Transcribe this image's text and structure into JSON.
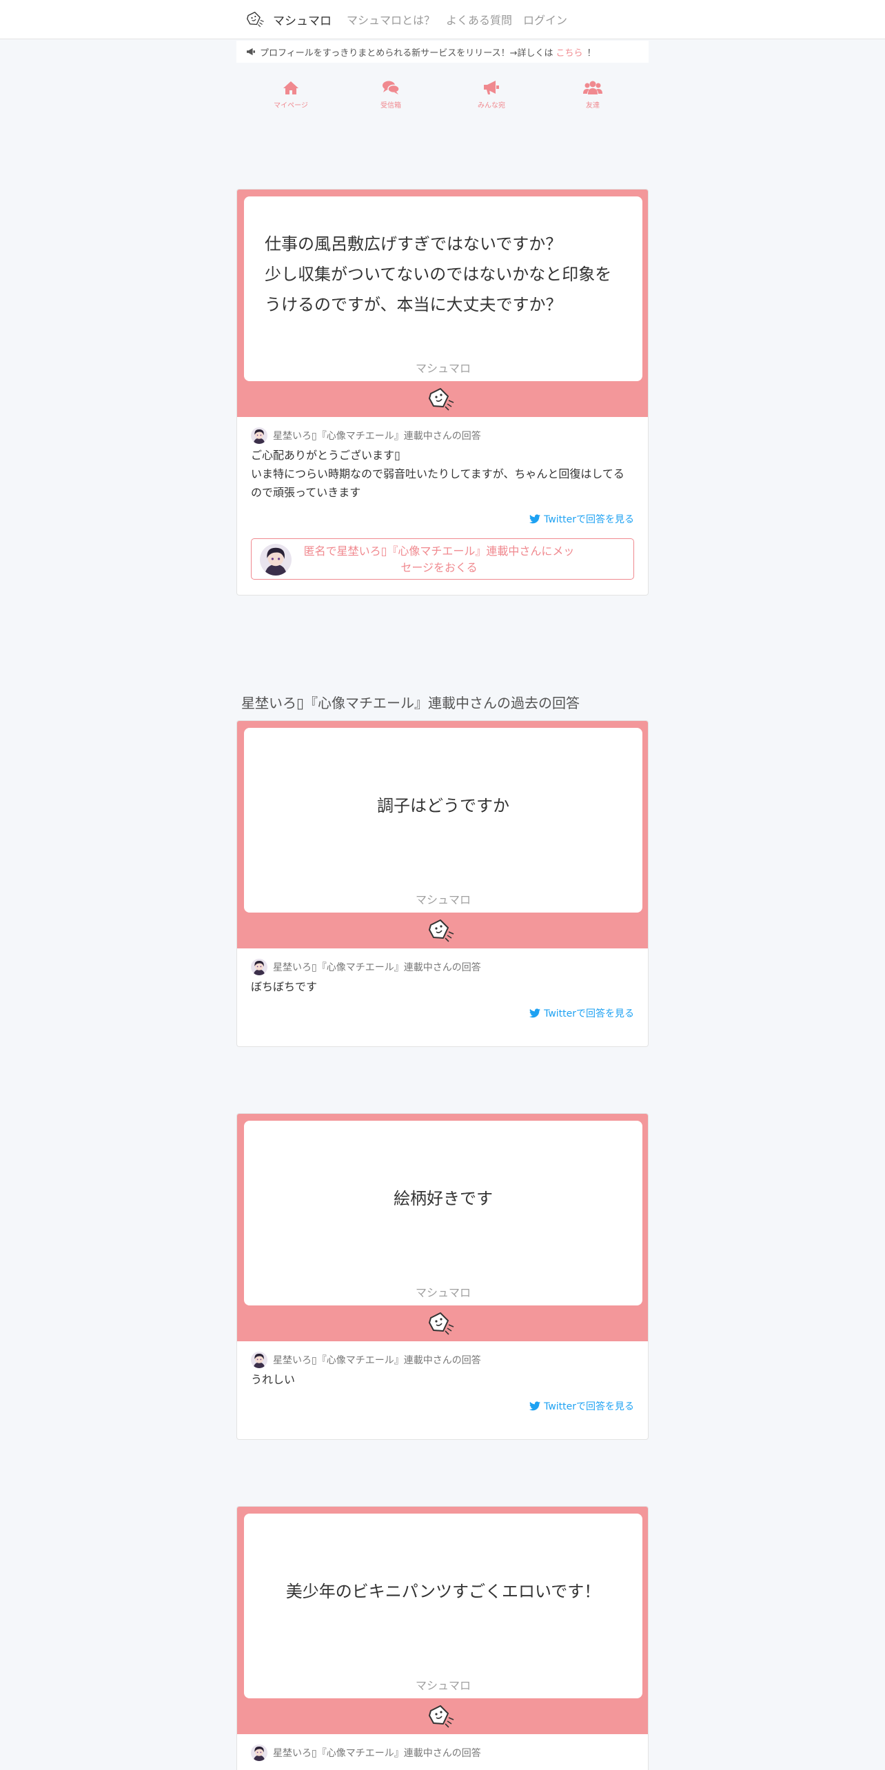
{
  "navbar": {
    "brand": "マシュマロ",
    "links": [
      "マシュマロとは？",
      "よくある質問",
      "ログイン"
    ]
  },
  "announcement": {
    "text": "プロフィールをすっきりまとめられる新サービスをリリース！→詳しくは",
    "link": "こちら",
    "suffix": "！"
  },
  "tabs": [
    {
      "label": "マイページ",
      "icon": "home-icon"
    },
    {
      "label": "受信箱",
      "icon": "comments-icon"
    },
    {
      "label": "みんな宛",
      "icon": "bullhorn-icon"
    },
    {
      "label": "友達",
      "icon": "users-icon"
    }
  ],
  "main": {
    "message": "仕事の風呂敷広げすぎではないですか？\n少し収集がついてないのではないかなと印象をうけるのですが、本当に大丈夫ですか？",
    "signature": "マシュマロ",
    "answer_by": "星埜いろ▯『心像マチエール』連載中さんの回答",
    "answer": "ご心配ありがとうございます▯\nいま特につらい時期なので弱音吐いたりしてますが、ちゃんと回復はしてるので頑張っていきます",
    "twitter_link": "Twitterで回答を見る",
    "send_button": "匿名で星埜いろ▯『心像マチエール』連載中さんにメッセージをおくる"
  },
  "past": {
    "title": "星埜いろ▯『心像マチエール』連載中さんの過去の回答",
    "items": [
      {
        "message": "調子はどうですか",
        "signature": "マシュマロ",
        "answer_by": "星埜いろ▯『心像マチエール』連載中さんの回答",
        "answer": "ぼちぼちです",
        "twitter_link": "Twitterで回答を見る"
      },
      {
        "message": "絵柄好きです",
        "signature": "マシュマロ",
        "answer_by": "星埜いろ▯『心像マチエール』連載中さんの回答",
        "answer": "うれしい",
        "twitter_link": "Twitterで回答を見る"
      },
      {
        "message": "美少年のビキニパンツすごくエロいです！",
        "signature": "マシュマロ",
        "answer_by": "星埜いろ▯『心像マチエール』連載中さんの回答"
      }
    ]
  },
  "colors": {
    "accent": "#f0898f",
    "frame": "#f3979a",
    "twitter": "#1da1f2",
    "background": "#f5f7fa"
  }
}
